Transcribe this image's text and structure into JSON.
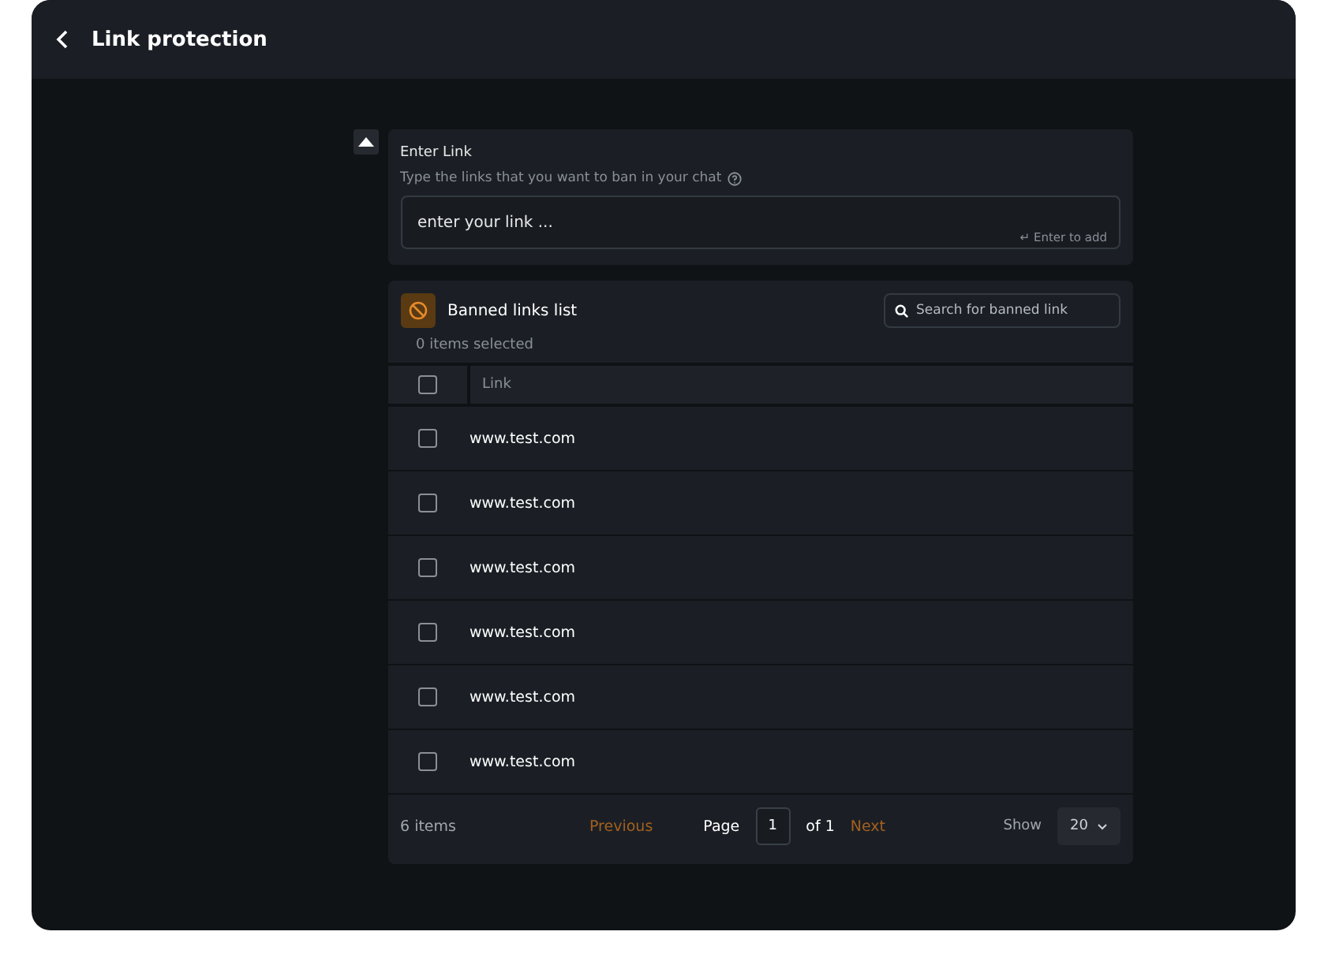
{
  "header": {
    "title": "Link protection"
  },
  "enter_link": {
    "title": "Enter Link",
    "hint": "Type the links that you want to ban in your chat",
    "placeholder": "enter your link ...",
    "shortcut": "↵ Enter to add"
  },
  "banned_list": {
    "title": "Banned links list",
    "search": {
      "placeholder": "Search for banned link"
    },
    "selection_count": "0 items selected",
    "table": {
      "select_all": {
        "checked": false
      },
      "columns": [
        "Link"
      ],
      "rows": [
        {
          "link": "www.test.com",
          "checked": false
        },
        {
          "link": "www.test.com",
          "checked": false
        },
        {
          "link": "www.test.com",
          "checked": false
        },
        {
          "link": "www.test.com",
          "checked": false
        },
        {
          "link": "www.test.com",
          "checked": false
        },
        {
          "link": "www.test.com",
          "checked": false
        }
      ]
    },
    "footer": {
      "count": "6 items",
      "previous": "Previous",
      "page_label": "Page",
      "page": "1",
      "of": "of 1",
      "next": "Next",
      "show_label": "Show",
      "page_size": "20"
    }
  }
}
